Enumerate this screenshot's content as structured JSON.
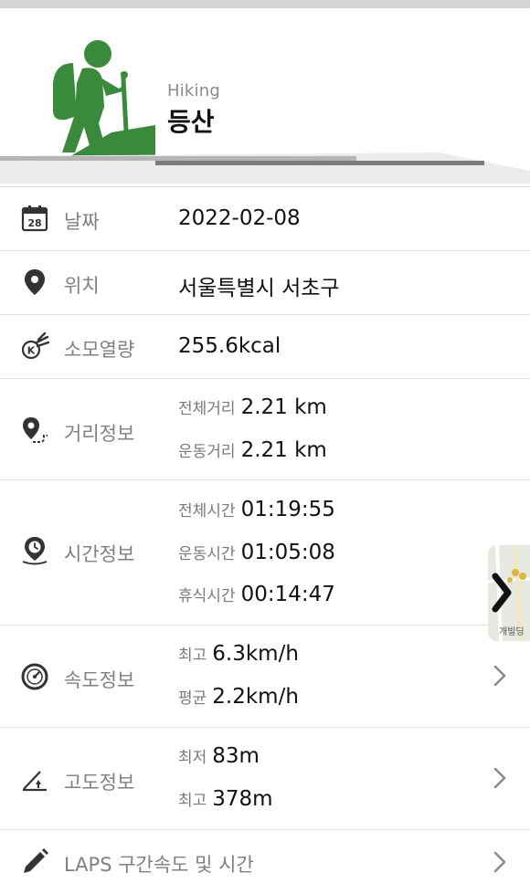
{
  "header": {
    "subtitle": "Hiking",
    "title": "등산"
  },
  "colors": {
    "accent": "#3a8a3c",
    "divider": "#e2e2e2",
    "label": "#808080"
  },
  "rows": {
    "date": {
      "icon": "calendar-icon",
      "icon_text": "28",
      "label": "날짜",
      "value": "2022-02-08"
    },
    "location": {
      "icon": "map-pin-icon",
      "label": "위치",
      "value": "서울특별시 서초구"
    },
    "calories": {
      "icon": "calorie-icon",
      "label": "소모열량",
      "value": "255.6kcal"
    },
    "distance": {
      "icon": "route-pin-icon",
      "label": "거리정보",
      "items": [
        {
          "key": "전체거리",
          "value": "2.21 km"
        },
        {
          "key": "운동거리",
          "value": "2.21 km"
        }
      ]
    },
    "time": {
      "icon": "clock-pin-icon",
      "label": "시간정보",
      "items": [
        {
          "key": "전체시간",
          "value": "01:19:55"
        },
        {
          "key": "운동시간",
          "value": "01:05:08"
        },
        {
          "key": "휴식시간",
          "value": "00:14:47"
        }
      ]
    },
    "speed": {
      "icon": "speedometer-icon",
      "label": "속도정보",
      "items": [
        {
          "key": "최고",
          "value": "6.3km/h"
        },
        {
          "key": "평균",
          "value": "2.2km/h"
        }
      ]
    },
    "altitude": {
      "icon": "altitude-icon",
      "label": "고도정보",
      "items": [
        {
          "key": "최저",
          "value": "83m"
        },
        {
          "key": "최고",
          "value": "378m"
        }
      ]
    },
    "laps": {
      "icon": "pencil-icon",
      "label": "LAPS 구간속도 및 시간"
    }
  },
  "map_thumb": {
    "label": "개빌딩"
  }
}
